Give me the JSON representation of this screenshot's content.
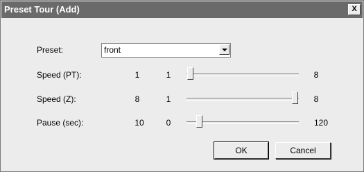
{
  "window": {
    "title": "Preset Tour (Add)",
    "close_glyph": "X"
  },
  "preset": {
    "label": "Preset:",
    "value": "front"
  },
  "sliders": [
    {
      "label": "Speed (PT):",
      "value": "1",
      "min": "1",
      "max": "8",
      "fraction": 0.0
    },
    {
      "label": "Speed (Z):",
      "value": "8",
      "min": "1",
      "max": "8",
      "fraction": 1.0
    },
    {
      "label": "Pause (sec):",
      "value": "10",
      "min": "0",
      "max": "120",
      "fraction": 0.083
    }
  ],
  "buttons": {
    "ok": "OK",
    "cancel": "Cancel"
  }
}
